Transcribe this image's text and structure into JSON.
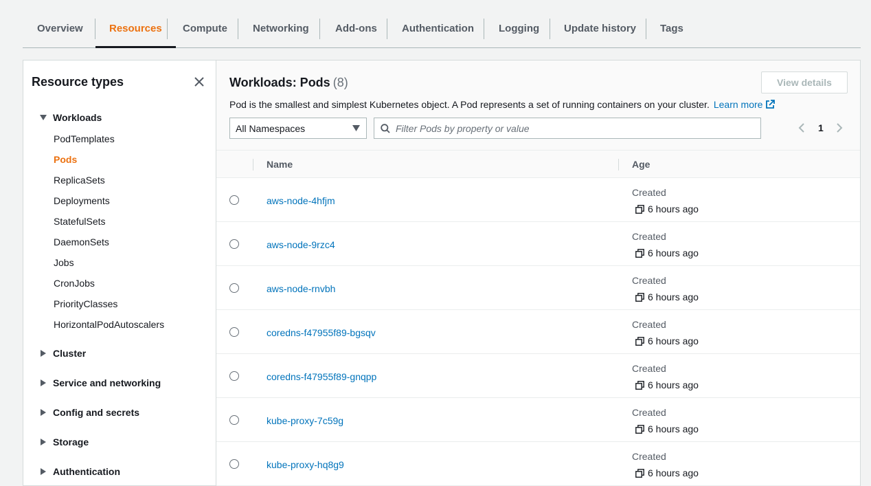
{
  "tabs": [
    {
      "label": "Overview"
    },
    {
      "label": "Resources"
    },
    {
      "label": "Compute"
    },
    {
      "label": "Networking"
    },
    {
      "label": "Add-ons"
    },
    {
      "label": "Authentication"
    },
    {
      "label": "Logging"
    },
    {
      "label": "Update history"
    },
    {
      "label": "Tags"
    }
  ],
  "active_tab": "Resources",
  "sidebar": {
    "title": "Resource types",
    "workloads_label": "Workloads",
    "workload_items": [
      {
        "label": "PodTemplates"
      },
      {
        "label": "Pods"
      },
      {
        "label": "ReplicaSets"
      },
      {
        "label": "Deployments"
      },
      {
        "label": "StatefulSets"
      },
      {
        "label": "DaemonSets"
      },
      {
        "label": "Jobs"
      },
      {
        "label": "CronJobs"
      },
      {
        "label": "PriorityClasses"
      },
      {
        "label": "HorizontalPodAutoscalers"
      }
    ],
    "active_item": "Pods",
    "collapsed_groups": [
      {
        "label": "Cluster"
      },
      {
        "label": "Service and networking"
      },
      {
        "label": "Config and secrets"
      },
      {
        "label": "Storage"
      },
      {
        "label": "Authentication"
      }
    ]
  },
  "main": {
    "title": "Workloads: Pods",
    "count": "(8)",
    "view_details_label": "View details",
    "description": "Pod is the smallest and simplest Kubernetes object. A Pod represents a set of running containers on your cluster.",
    "learn_more": "Learn more",
    "namespace_value": "All Namespaces",
    "filter_placeholder": "Filter Pods by property or value",
    "page": "1",
    "columns": {
      "name": "Name",
      "age": "Age"
    },
    "rows": [
      {
        "name": "aws-node-4hfjm",
        "created_label": "Created",
        "age": "6 hours ago"
      },
      {
        "name": "aws-node-9rzc4",
        "created_label": "Created",
        "age": "6 hours ago"
      },
      {
        "name": "aws-node-rnvbh",
        "created_label": "Created",
        "age": "6 hours ago"
      },
      {
        "name": "coredns-f47955f89-bgsqv",
        "created_label": "Created",
        "age": "6 hours ago"
      },
      {
        "name": "coredns-f47955f89-gnqpp",
        "created_label": "Created",
        "age": "6 hours ago"
      },
      {
        "name": "kube-proxy-7c59g",
        "created_label": "Created",
        "age": "6 hours ago"
      },
      {
        "name": "kube-proxy-hq8g9",
        "created_label": "Created",
        "age": "6 hours ago"
      }
    ]
  },
  "colors": {
    "accent_orange": "#ec7211",
    "link_blue": "#0073bb",
    "text": "#16191f",
    "muted": "#545b64"
  },
  "icons": [
    "close-icon",
    "caret-down-icon",
    "caret-right-icon",
    "search-icon",
    "external-link-icon",
    "chevron-left-icon",
    "chevron-right-icon",
    "copy-icon"
  ]
}
